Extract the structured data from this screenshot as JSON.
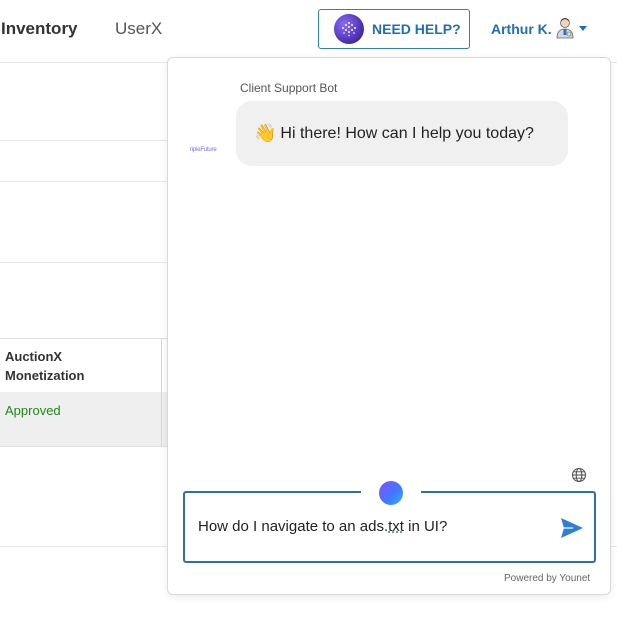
{
  "nav": {
    "tabs": [
      {
        "label": "Inventory"
      },
      {
        "label": "UserX"
      }
    ],
    "help_button": {
      "label": "NEED HELP?",
      "icon": "bot-logo-icon"
    },
    "user": {
      "name": "Arthur K.",
      "avatar_icon": "user-avatar-icon"
    }
  },
  "table": {
    "column_title_line1": "AuctionX",
    "column_title_line2": "Monetization",
    "row_status": "Approved"
  },
  "chat": {
    "bot_name": "Client Support Bot",
    "bot_avatar_text": "ripleFuture",
    "greeting_emoji": "👋",
    "greeting_text": "Hi there! How can I help you today?",
    "input_prefix": "How do I navigate to an ads.",
    "input_highlight": "txt",
    "input_suffix": " in UI?",
    "powered_by": "Powered by Younet"
  },
  "colors": {
    "accent_blue": "#1f6fb7",
    "approved_green": "#1a8a1a",
    "bubble_bg": "#f0f0f0"
  }
}
